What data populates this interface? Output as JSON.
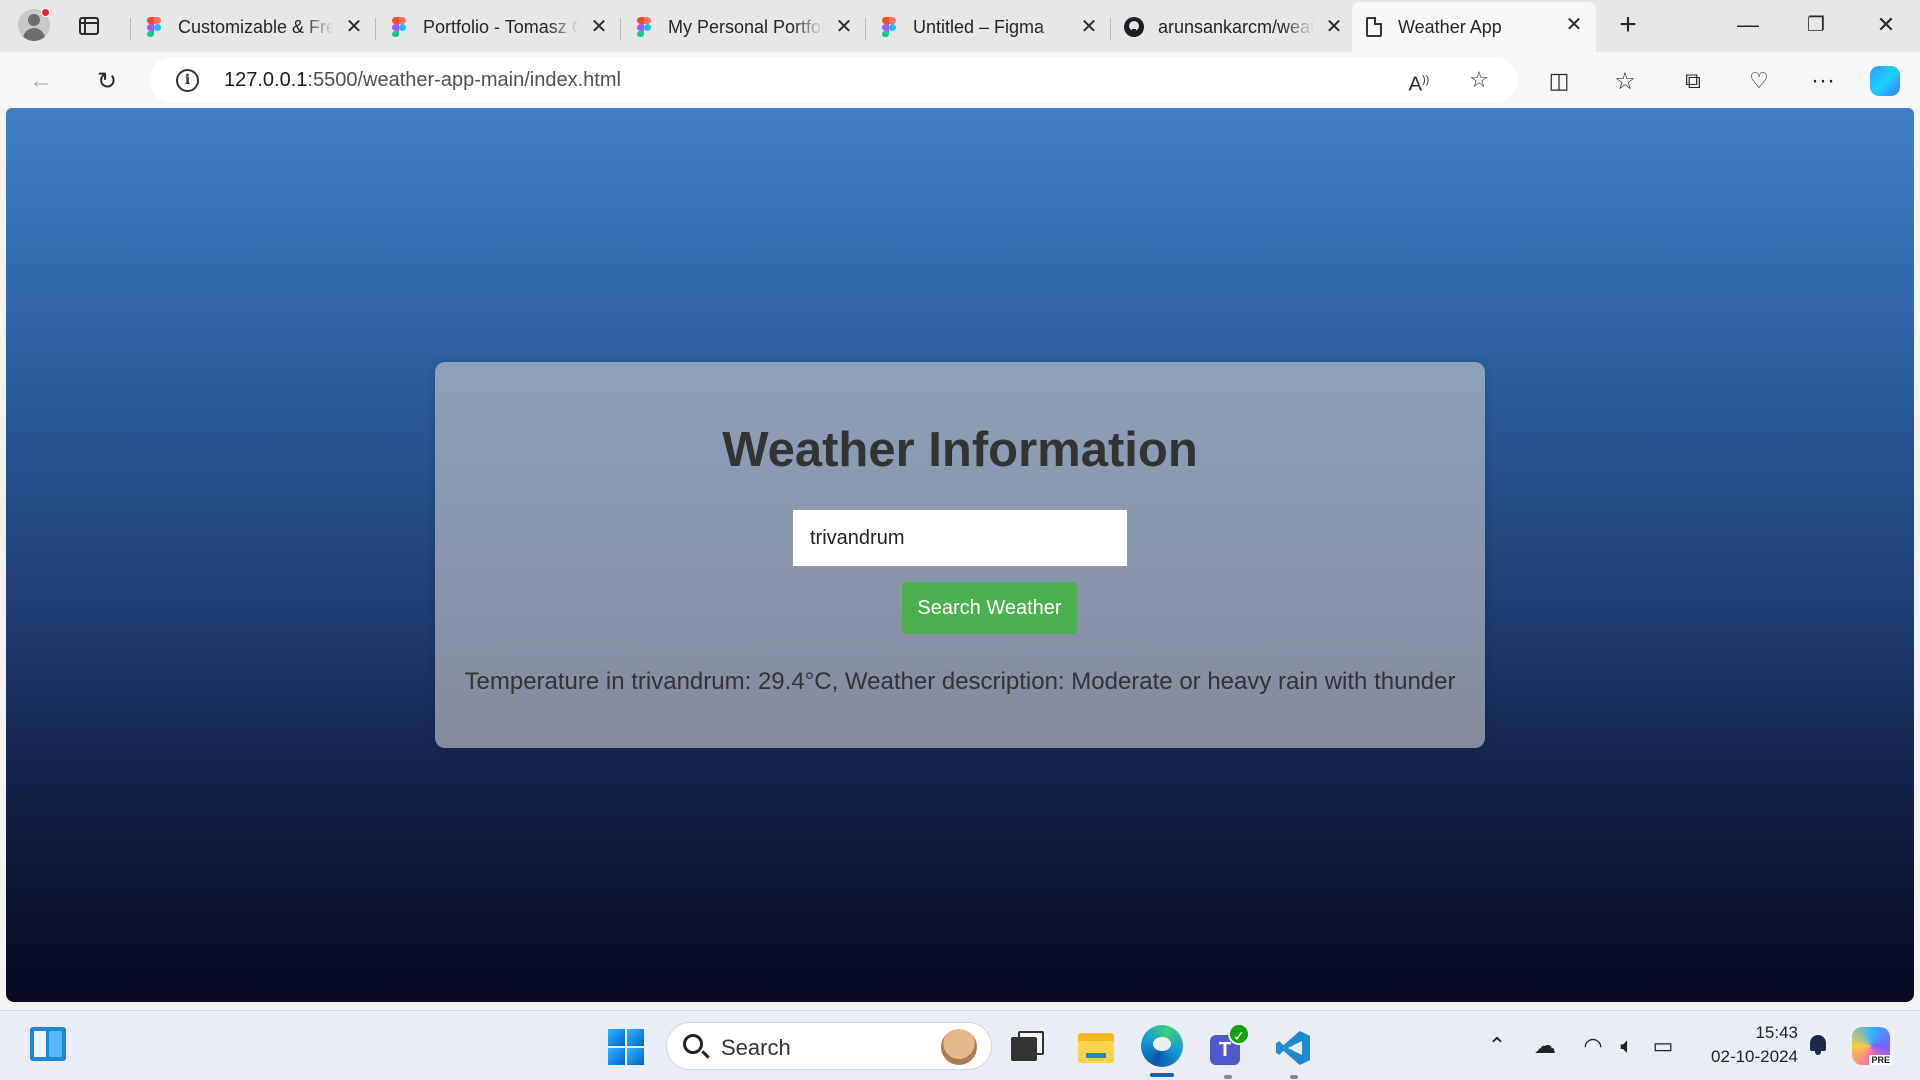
{
  "browser": {
    "tabs": [
      {
        "title": "Customizable & Free",
        "icon": "figma-icon",
        "active": false
      },
      {
        "title": "Portfolio - Tomasz G",
        "icon": "figma-icon",
        "active": false
      },
      {
        "title": "My Personal Portfolio",
        "icon": "figma-icon",
        "active": false
      },
      {
        "title": "Untitled – Figma",
        "icon": "figma-icon",
        "active": false
      },
      {
        "title": "arunsankarcm/weather",
        "icon": "github-icon",
        "active": false
      },
      {
        "title": "Weather App",
        "icon": "page-icon",
        "active": true
      }
    ],
    "url_host": "127.0.0.1",
    "url_path": ":5500/weather-app-main/index.html"
  },
  "page": {
    "heading": "Weather Information",
    "city_value": "trivandrum",
    "search_button": "Search Weather",
    "result_text": "Temperature in trivandrum: 29.4°C, Weather description: Moderate or heavy rain with thunder"
  },
  "taskbar": {
    "search_label": "Search",
    "time": "15:43",
    "date": "02-10-2024",
    "copilot_badge": "PRE"
  },
  "colors": {
    "button_green": "#4caf50",
    "gradient_top": "#3e80c6",
    "gradient_bottom": "#080a22",
    "accent": "#0067c0"
  }
}
